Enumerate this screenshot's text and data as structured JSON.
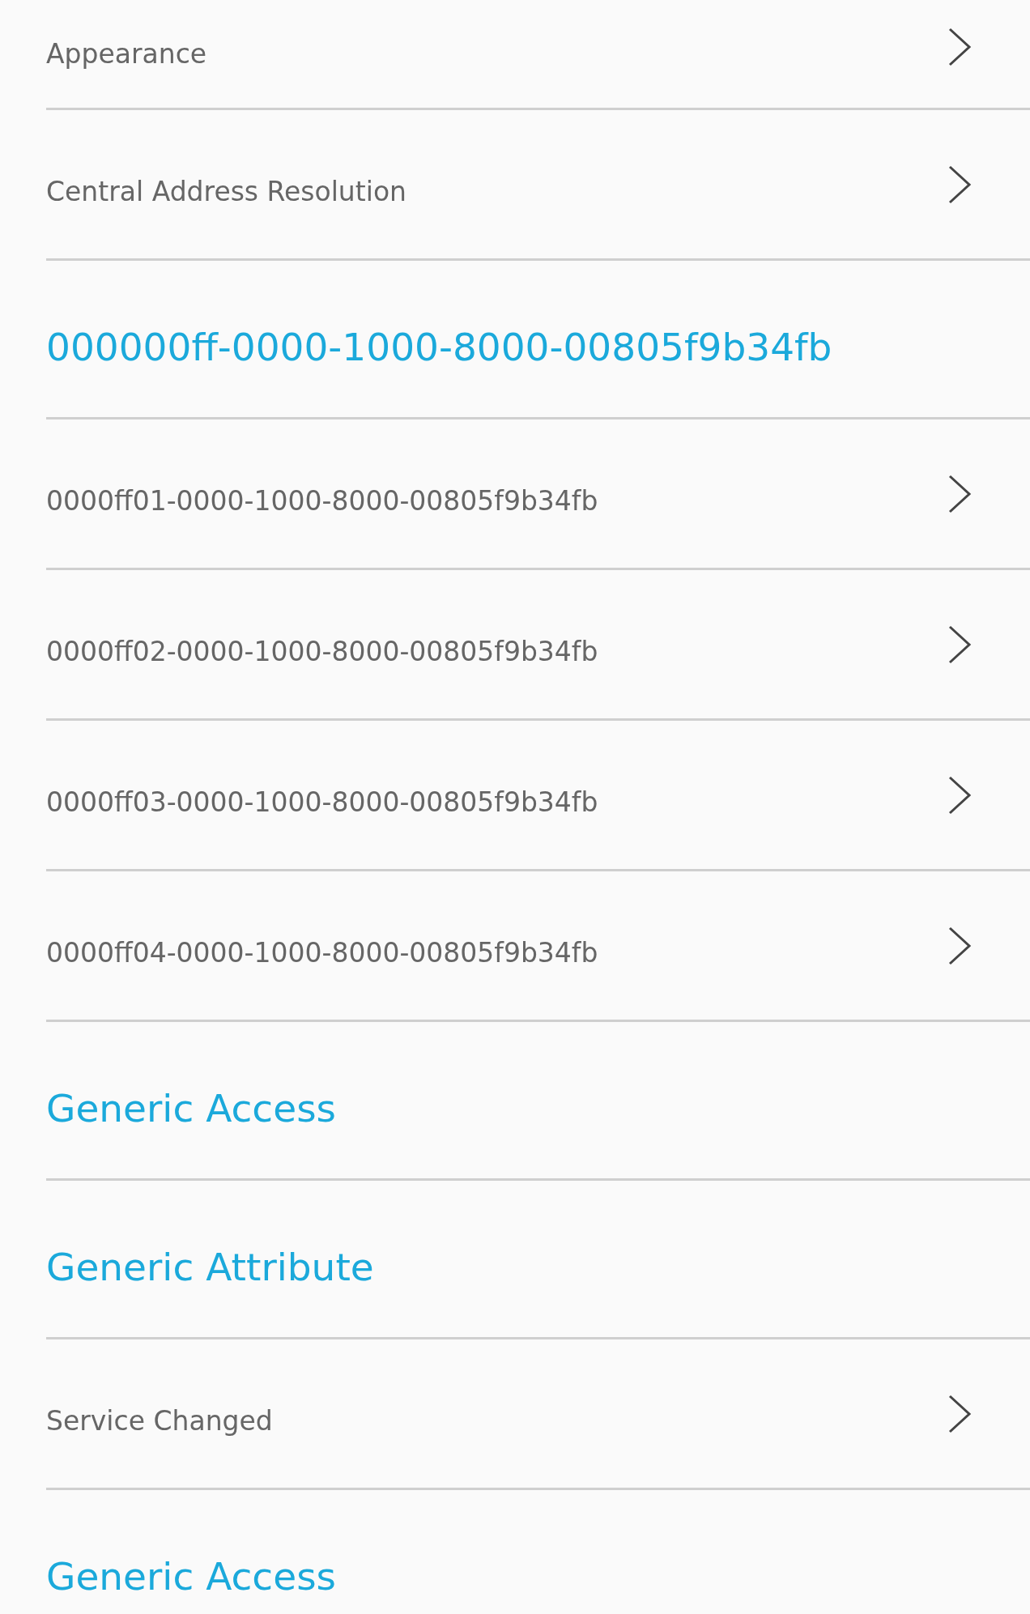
{
  "rows": [
    {
      "kind": "characteristic",
      "label": "Appearance"
    },
    {
      "kind": "characteristic",
      "label": "Central Address Resolution"
    },
    {
      "kind": "service",
      "label": "000000ff-0000-1000-8000-00805f9b34fb"
    },
    {
      "kind": "characteristic",
      "label": "0000ff01-0000-1000-8000-00805f9b34fb"
    },
    {
      "kind": "characteristic",
      "label": "0000ff02-0000-1000-8000-00805f9b34fb"
    },
    {
      "kind": "characteristic",
      "label": "0000ff03-0000-1000-8000-00805f9b34fb"
    },
    {
      "kind": "characteristic",
      "label": "0000ff04-0000-1000-8000-00805f9b34fb"
    },
    {
      "kind": "service",
      "label": "Generic Access"
    },
    {
      "kind": "service",
      "label": "Generic Attribute"
    },
    {
      "kind": "characteristic",
      "label": "Service Changed"
    },
    {
      "kind": "service",
      "label": "Generic Access"
    }
  ]
}
